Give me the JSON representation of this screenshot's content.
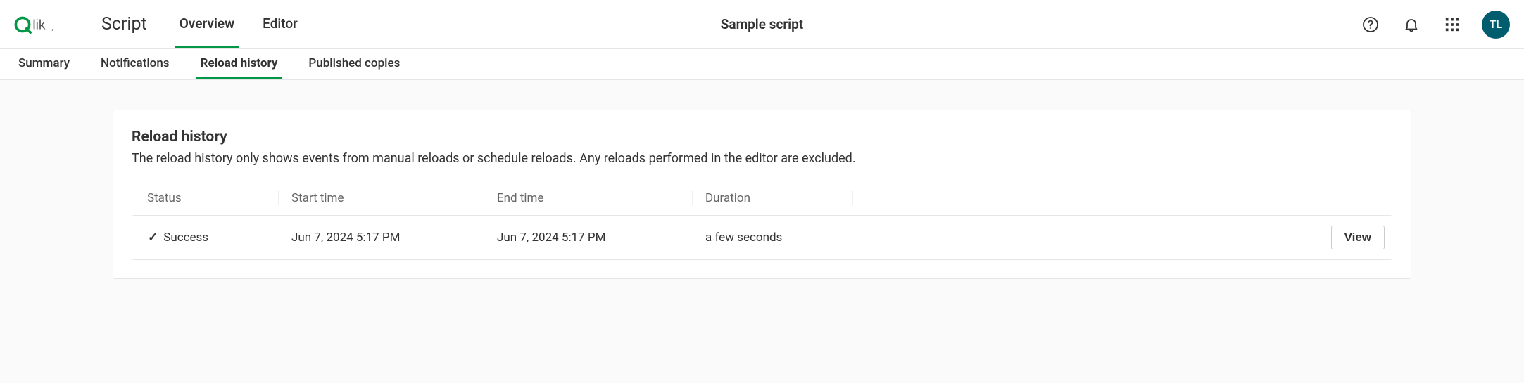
{
  "brand": {
    "name": "Qlik"
  },
  "header": {
    "app_name": "Script",
    "title": "Sample script",
    "tabs": [
      {
        "label": "Overview",
        "active": true
      },
      {
        "label": "Editor",
        "active": false
      }
    ],
    "avatar_initials": "TL"
  },
  "subnav": {
    "tabs": [
      {
        "label": "Summary",
        "active": false
      },
      {
        "label": "Notifications",
        "active": false
      },
      {
        "label": "Reload history",
        "active": true
      },
      {
        "label": "Published copies",
        "active": false
      }
    ]
  },
  "card": {
    "title": "Reload history",
    "description": "The reload history only shows events from manual reloads or schedule reloads. Any reloads performed in the editor are excluded."
  },
  "table": {
    "columns": {
      "status": "Status",
      "start": "Start time",
      "end": "End time",
      "duration": "Duration"
    },
    "rows": [
      {
        "status": "Success",
        "start": "Jun 7, 2024 5:17 PM",
        "end": "Jun 7, 2024 5:17 PM",
        "duration": "a few seconds",
        "action_label": "View"
      }
    ]
  }
}
